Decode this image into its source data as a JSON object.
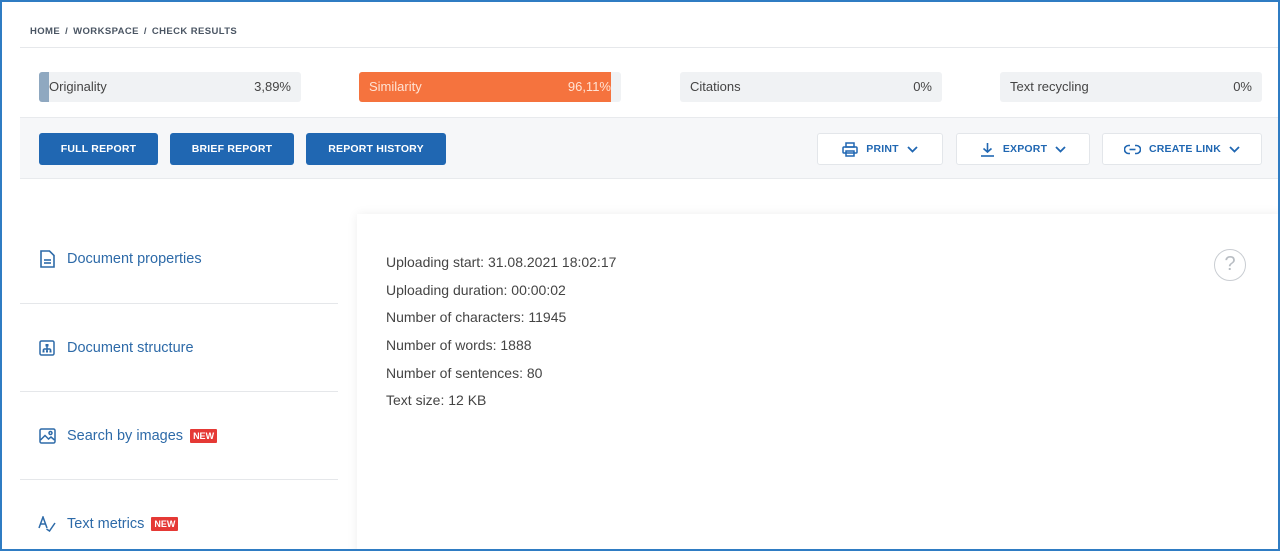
{
  "breadcrumb": [
    "HOME",
    "WORKSPACE",
    "CHECK RESULTS"
  ],
  "breadcrumb_sep": "/",
  "metrics": {
    "originality": {
      "label": "Originality",
      "value": "3,89%",
      "fraction": 0.0389
    },
    "similarity": {
      "label": "Similarity",
      "value": "96,11%",
      "fraction": 0.9611
    },
    "citations": {
      "label": "Citations",
      "value": "0%",
      "fraction": 0
    },
    "text_recycling": {
      "label": "Text recycling",
      "value": "0%",
      "fraction": 0
    }
  },
  "toolbar": {
    "full_report": "FULL REPORT",
    "brief_report": "BRIEF REPORT",
    "report_history": "REPORT HISTORY",
    "print": "PRINT",
    "export": "EXPORT",
    "create_link": "CREATE LINK"
  },
  "sidebar": {
    "items": [
      {
        "label": "Document properties",
        "icon": "document-icon",
        "badge": ""
      },
      {
        "label": "Document structure",
        "icon": "structure-icon",
        "badge": ""
      },
      {
        "label": "Search by images",
        "icon": "image-icon",
        "badge": "NEW"
      },
      {
        "label": "Text metrics",
        "icon": "text-metrics-icon",
        "badge": "NEW"
      }
    ]
  },
  "properties": [
    "Uploading start: 31.08.2021 18:02:17",
    "Uploading duration: 00:00:02",
    "Number of characters: 11945",
    "Number of words: 1888",
    "Number of sentences: 80",
    "Text size: 12 KB"
  ],
  "help_symbol": "?",
  "colors": {
    "primary": "#2067b2",
    "similarity": "#f5733e",
    "originality": "#8fa8c0",
    "badge": "#e53935",
    "frame": "#2f7cc3"
  }
}
